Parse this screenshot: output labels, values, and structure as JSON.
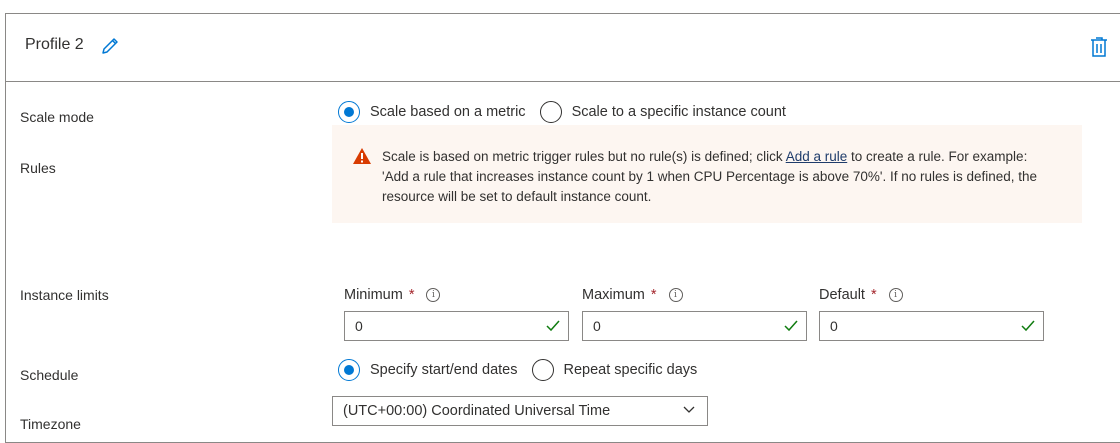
{
  "header": {
    "title": "Profile 2",
    "edit_icon": "pencil-icon",
    "delete_icon": "trash-icon"
  },
  "scale_mode": {
    "label": "Scale mode",
    "options": [
      "Scale based on a metric",
      "Scale to a specific instance count"
    ],
    "selected": "Scale based on a metric"
  },
  "rules": {
    "label": "Rules",
    "warning_part1": "Scale is based on metric trigger rules but no rule(s) is defined; click ",
    "warning_link": "Add a rule",
    "warning_part2": " to create a rule. For example: 'Add a rule that increases instance count by 1 when CPU Percentage is above 70%'. If no rules is defined, the resource will be set to default instance count."
  },
  "instance_limits": {
    "label": "Instance limits",
    "required_mark": "*",
    "minimum": {
      "label": "Minimum",
      "value": "0"
    },
    "maximum": {
      "label": "Maximum",
      "value": "0"
    },
    "default": {
      "label": "Default",
      "value": "0"
    }
  },
  "schedule": {
    "label": "Schedule",
    "options": [
      "Specify start/end dates",
      "Repeat specific days"
    ],
    "selected": "Specify start/end dates"
  },
  "timezone": {
    "label": "Timezone",
    "value": "(UTC+00:00) Coordinated Universal Time"
  },
  "colors": {
    "accent": "#0078d4",
    "warning_bg": "#fdf6f1",
    "warning_icon": "#d83b01",
    "required": "#a4262c",
    "valid_check": "#107c10"
  }
}
